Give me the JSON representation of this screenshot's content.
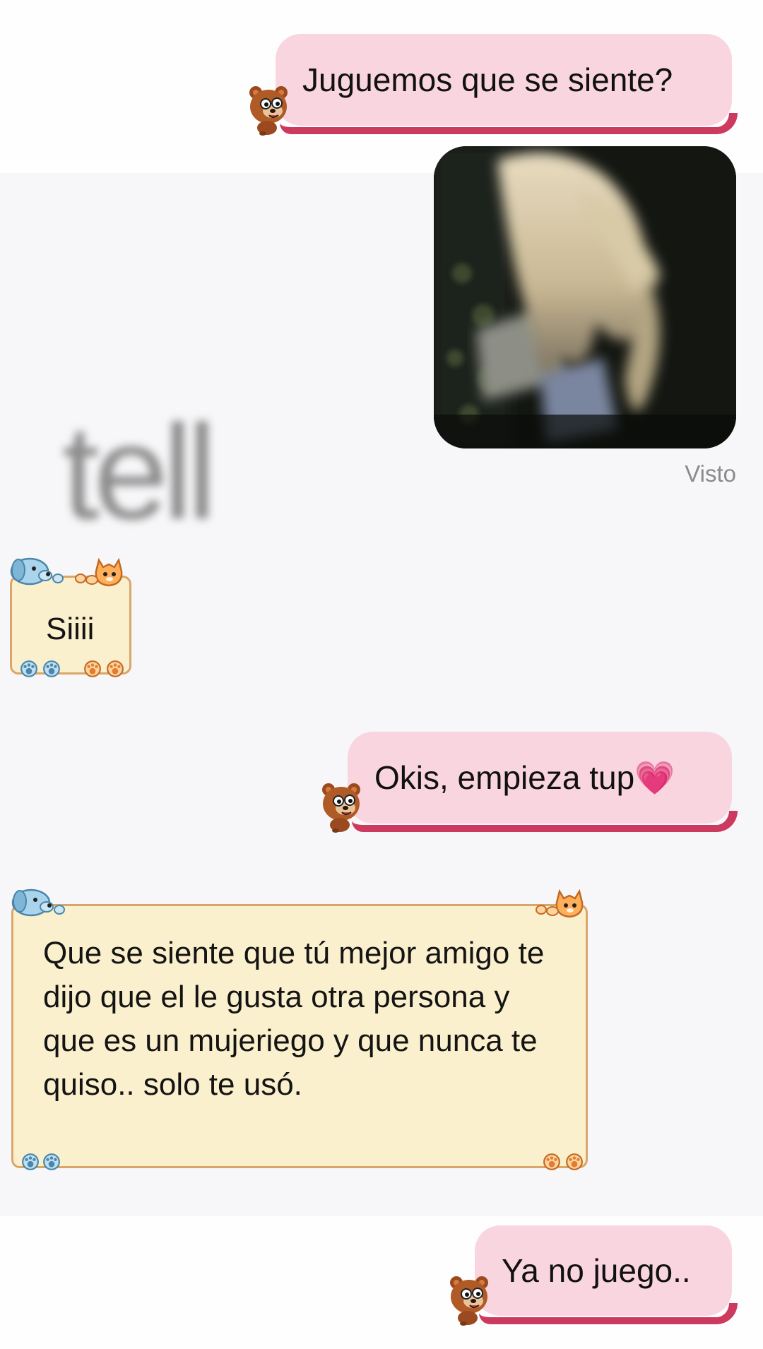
{
  "conversation": {
    "messages": [
      {
        "side": "sent",
        "text": "Juguemos que se siente?"
      },
      {
        "side": "sent",
        "type": "photo",
        "status": "Visto"
      },
      {
        "side": "received",
        "text": "Siiii"
      },
      {
        "side": "sent",
        "text": "Okis, empieza tup💗"
      },
      {
        "side": "received",
        "text": "Que se siente que tú mejor amigo te dijo que el le gusta otra persona y que es un mujeriego y que nunca te quiso.. solo te usó."
      },
      {
        "side": "sent",
        "text": "Ya no juego.."
      }
    ],
    "watermark": "tell"
  },
  "colors": {
    "sent_bubble": "#f9d5e0",
    "sent_accent": "#cc3a5f",
    "received_bubble": "#fbf0cd",
    "received_border": "#d9a66a",
    "status_text": "#8a8a8a"
  },
  "icons": {
    "sender_sticker": "bear-icon",
    "received_decor": [
      "dog-icon",
      "cat-icon",
      "paw-icon"
    ]
  }
}
